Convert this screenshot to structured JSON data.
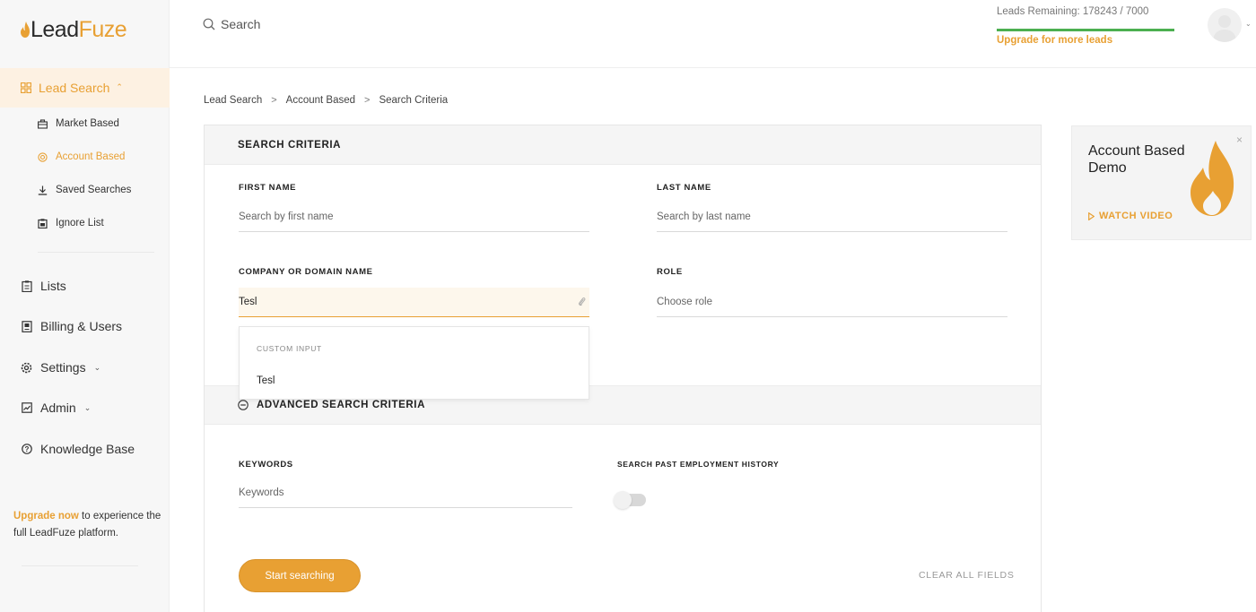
{
  "brand": {
    "name_part1": "Lead",
    "name_part2": "Fuze",
    "accent": "#e8a033",
    "progress": "#4caf50"
  },
  "topbar": {
    "search_label": "Search",
    "leads_remaining": "Leads Remaining: 178243 / 7000",
    "leads_progress_fraction": 1.0,
    "upgrade_link": "Upgrade for more leads"
  },
  "sidebar": {
    "lead_search": "Lead Search",
    "sub_items": [
      {
        "label": "Market Based",
        "icon": "briefcase-icon"
      },
      {
        "label": "Account Based",
        "icon": "target-icon"
      },
      {
        "label": "Saved Searches",
        "icon": "download-icon"
      },
      {
        "label": "Ignore List",
        "icon": "clipboard-icon"
      }
    ],
    "items": [
      {
        "label": "Lists",
        "icon": "clipboard-list-icon"
      },
      {
        "label": "Billing & Users",
        "icon": "document-icon"
      },
      {
        "label": "Settings",
        "icon": "gear-icon"
      },
      {
        "label": "Admin",
        "icon": "admin-icon"
      },
      {
        "label": "Knowledge Base",
        "icon": "question-icon"
      }
    ],
    "upgrade_now": "Upgrade now",
    "upgrade_rest": " to experience the full LeadFuze platform."
  },
  "breadcrumb": [
    "Lead Search",
    "Account Based",
    "Search Criteria"
  ],
  "breadcrumb_separator": ">",
  "search_criteria": {
    "header": "SEARCH CRITERIA",
    "first_name_label": "FIRST NAME",
    "first_name_placeholder": "Search by first name",
    "last_name_label": "LAST NAME",
    "last_name_placeholder": "Search by last name",
    "company_label": "COMPANY OR DOMAIN NAME",
    "company_value": "Tesl",
    "role_label": "ROLE",
    "role_placeholder": "Choose role",
    "dropdown_header": "CUSTOM INPUT",
    "dropdown_option": "Tesl",
    "advanced_label": "ADVANCED SEARCH CRITERIA",
    "keywords_label": "KEYWORDS",
    "keywords_placeholder": "Keywords",
    "past_employment_label": "SEARCH PAST EMPLOYMENT HISTORY",
    "past_employment_enabled": false,
    "start_button": "Start searching",
    "clear_button": "CLEAR ALL FIELDS"
  },
  "demo_card": {
    "title": "Account Based Demo",
    "watch_label": "WATCH VIDEO",
    "close_label": "×"
  }
}
